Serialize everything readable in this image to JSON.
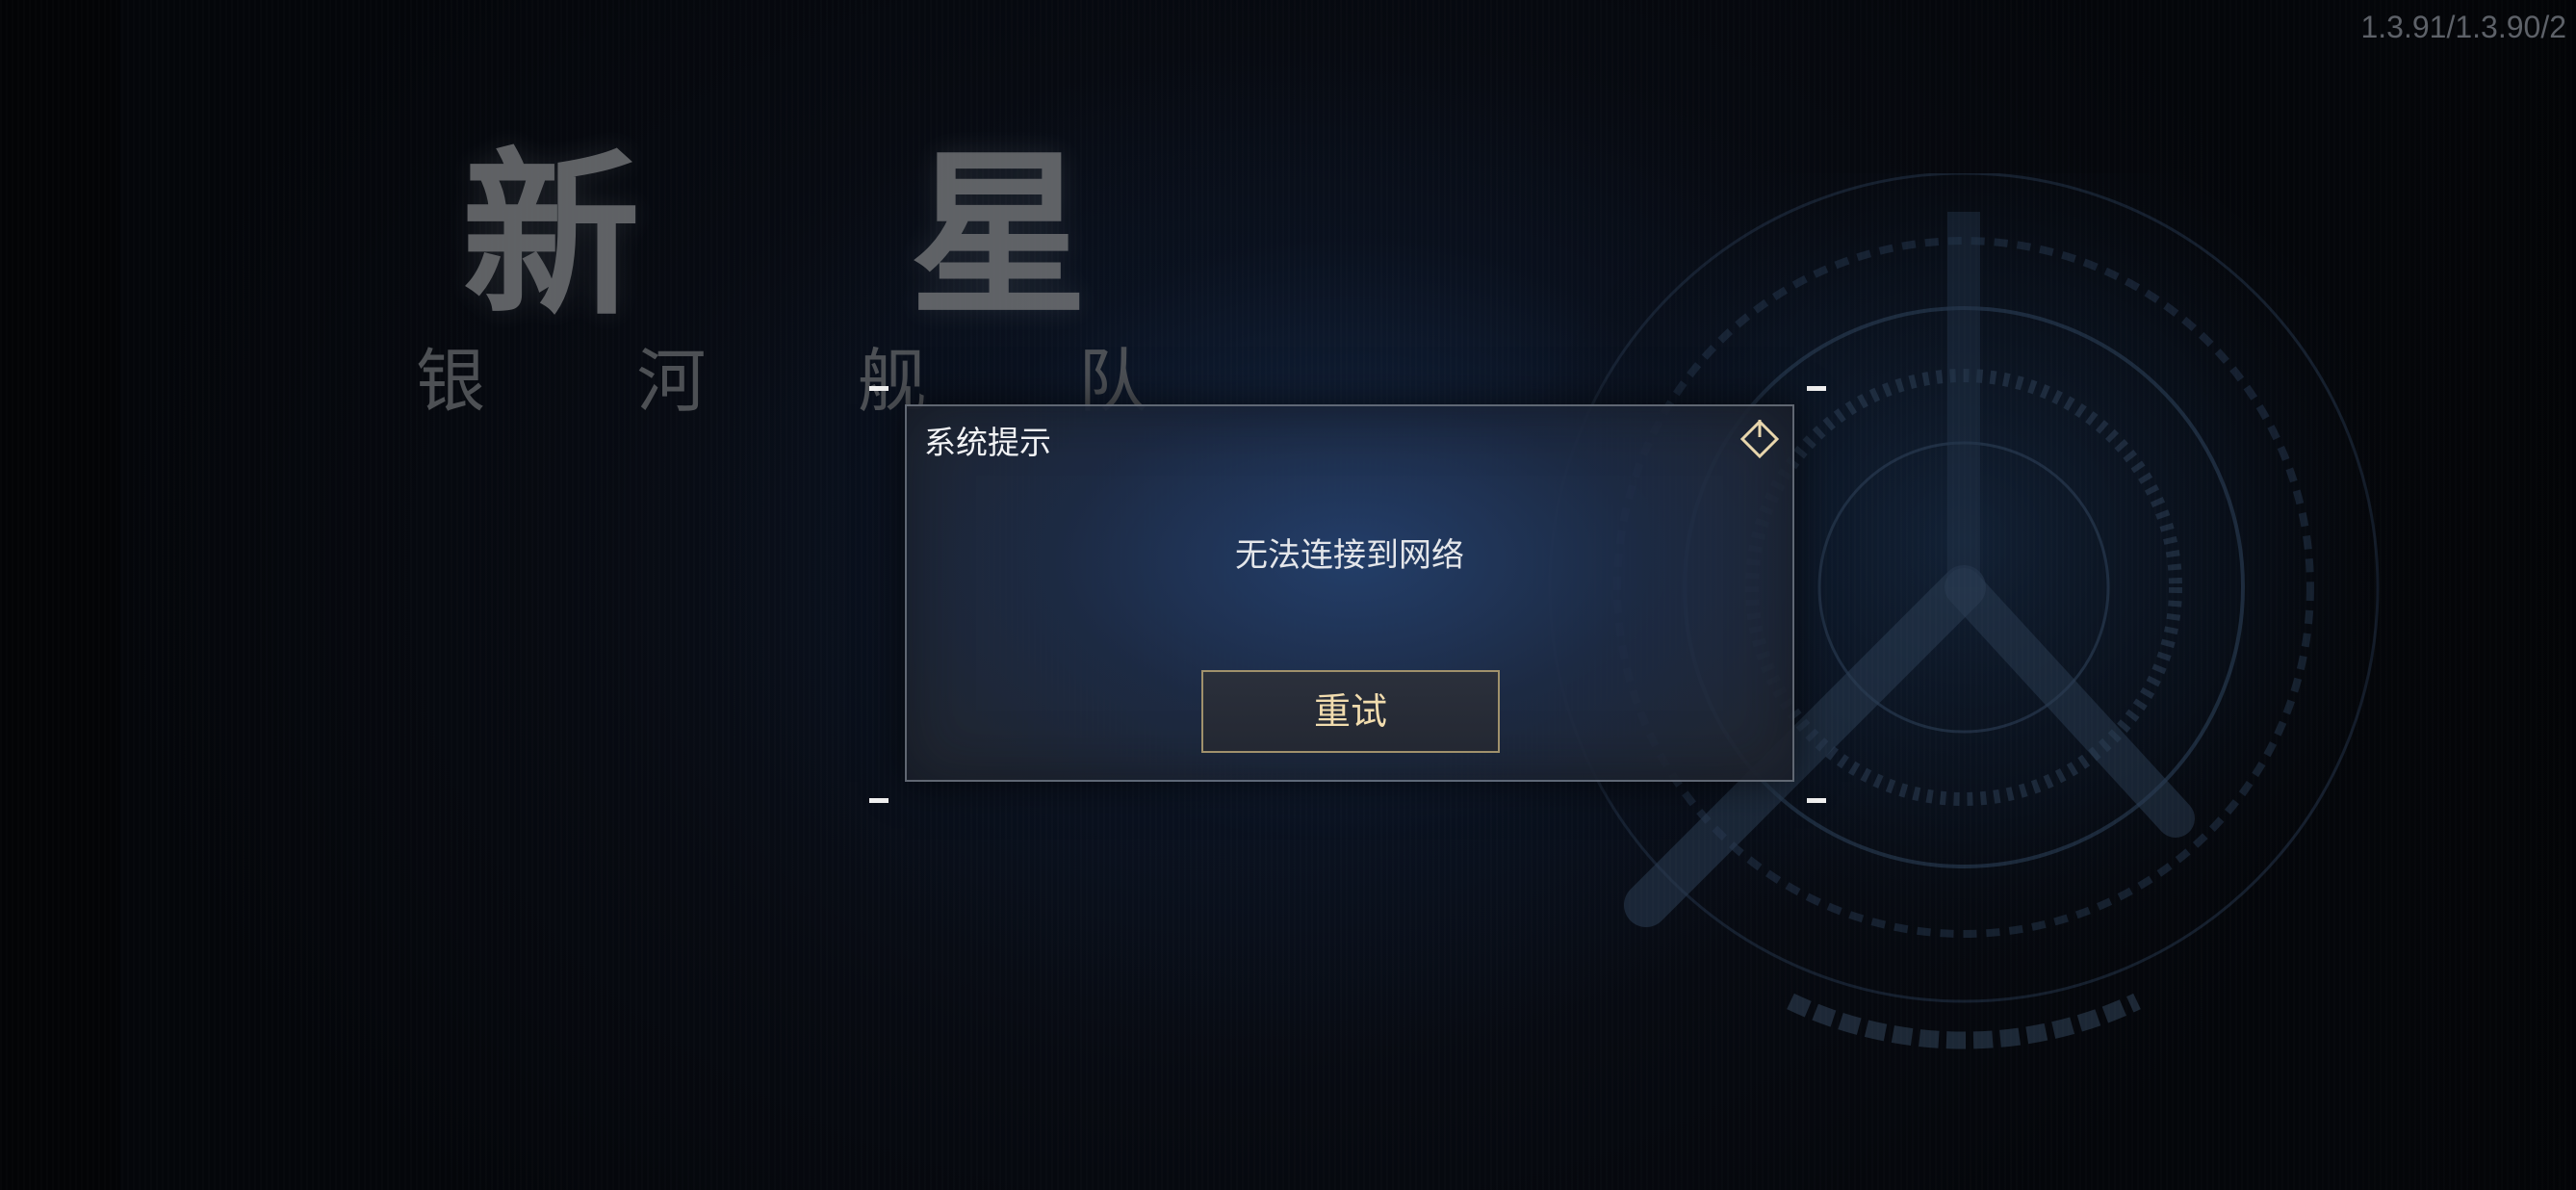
{
  "version": "1.3.91/1.3.90/2",
  "logo": {
    "main": [
      "新",
      "星"
    ],
    "sub": [
      "银",
      "河",
      "舰",
      "队"
    ]
  },
  "dialog": {
    "title": "系统提示",
    "message": "无法连接到网络",
    "retry_label": "重试",
    "close_icon": "diamond-power-icon"
  },
  "colors": {
    "accent_gold": "#f1dcae",
    "button_border": "#a0916c",
    "dialog_bg": "#1e2c46"
  }
}
